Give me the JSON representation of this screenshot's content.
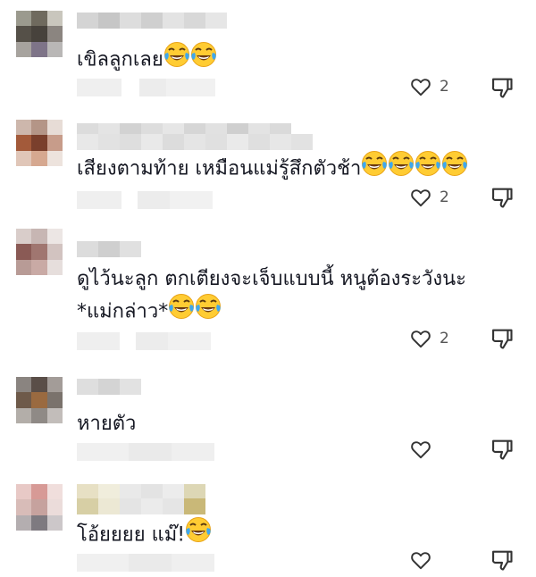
{
  "comments": [
    {
      "text_before": "เขิลลูกเลย",
      "emojis": [
        "face-with-tears-of-joy",
        "face-with-tears-of-joy"
      ],
      "like_count": "2",
      "text_line2": ""
    },
    {
      "text_before": "เสียงตามท้าย เหมือนแม่รู้สึกตัวช้า",
      "emojis": [
        "face-with-tears-of-joy",
        "face-with-tears-of-joy",
        "face-with-tears-of-joy",
        "face-with-tears-of-joy"
      ],
      "like_count": "2",
      "text_line2": ""
    },
    {
      "text_before": "ดูไว้นะลูก ตกเตียงจะเจ็บแบบนี้ หนูต้องระวังนะ",
      "text_line2": "*แม่กล่าว*",
      "emojis": [
        "face-with-tears-of-joy",
        "face-with-tears-of-joy"
      ],
      "like_count": "2"
    },
    {
      "text_before": "หายตัว",
      "emojis": [],
      "like_count": "",
      "text_line2": ""
    },
    {
      "text_before": "โอ้ยยยย แม๊!",
      "emojis": [
        "face-with-tears-of-joy"
      ],
      "like_count": "",
      "text_line2": ""
    }
  ],
  "icons": {
    "like": "heart-outline-icon",
    "dislike": "thumbs-down-outline-icon",
    "emoji": "face-with-tears-of-joy"
  },
  "colors": {
    "text": "#161823",
    "icon": "#333333",
    "muted": "#555555",
    "blur_light": "#ececec"
  }
}
